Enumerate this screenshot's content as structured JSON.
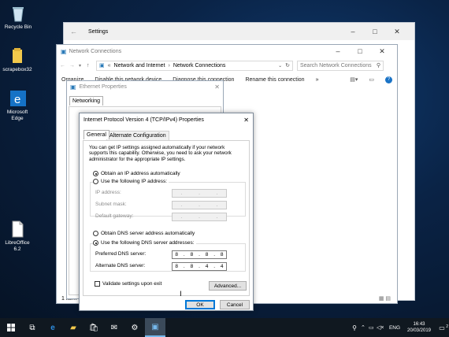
{
  "desktop": {
    "icons": [
      {
        "label": "Recycle Bin"
      },
      {
        "label": "scrapebox32"
      },
      {
        "label": "Microsoft Edge"
      },
      {
        "label": "LibreOffice 6.2"
      }
    ]
  },
  "settings_window": {
    "title": "Settings"
  },
  "network_connections": {
    "title": "Network Connections",
    "breadcrumb": [
      "Network and Internet",
      "Network Connections"
    ],
    "search_placeholder": "Search Network Connections",
    "toolbar": {
      "organize": "Organize",
      "disable": "Disable this network device",
      "diagnose": "Diagnose this connection",
      "rename": "Rename this connection",
      "more": "»"
    },
    "status": "1 item"
  },
  "ethernet_properties": {
    "title": "Ethernet Properties",
    "tab": "Networking"
  },
  "ipv4_dialog": {
    "title": "Internet Protocol Version 4 (TCP/IPv4) Properties",
    "tabs": [
      "General",
      "Alternate Configuration"
    ],
    "description": "You can get IP settings assigned automatically if your network supports this capability. Otherwise, you need to ask your network administrator for the appropriate IP settings.",
    "obtain_ip_auto": "Obtain an IP address automatically",
    "use_following_ip": "Use the following IP address:",
    "ip_address_label": "IP address:",
    "subnet_label": "Subnet mask:",
    "gateway_label": "Default gateway:",
    "obtain_dns_auto": "Obtain DNS server address automatically",
    "use_following_dns": "Use the following DNS server addresses:",
    "preferred_dns_label": "Preferred DNS server:",
    "preferred_dns": [
      "8",
      "8",
      "8",
      "8"
    ],
    "alternate_dns_label": "Alternate DNS server:",
    "alternate_dns": [
      "8",
      "8",
      "4",
      "4"
    ],
    "validate_label": "Validate settings upon exit",
    "advanced_button": "Advanced...",
    "ok_button": "OK",
    "cancel_button": "Cancel"
  },
  "taskbar": {
    "lang": "ENG",
    "time": "16:43",
    "date": "20/03/2019",
    "notification_count": "2"
  }
}
